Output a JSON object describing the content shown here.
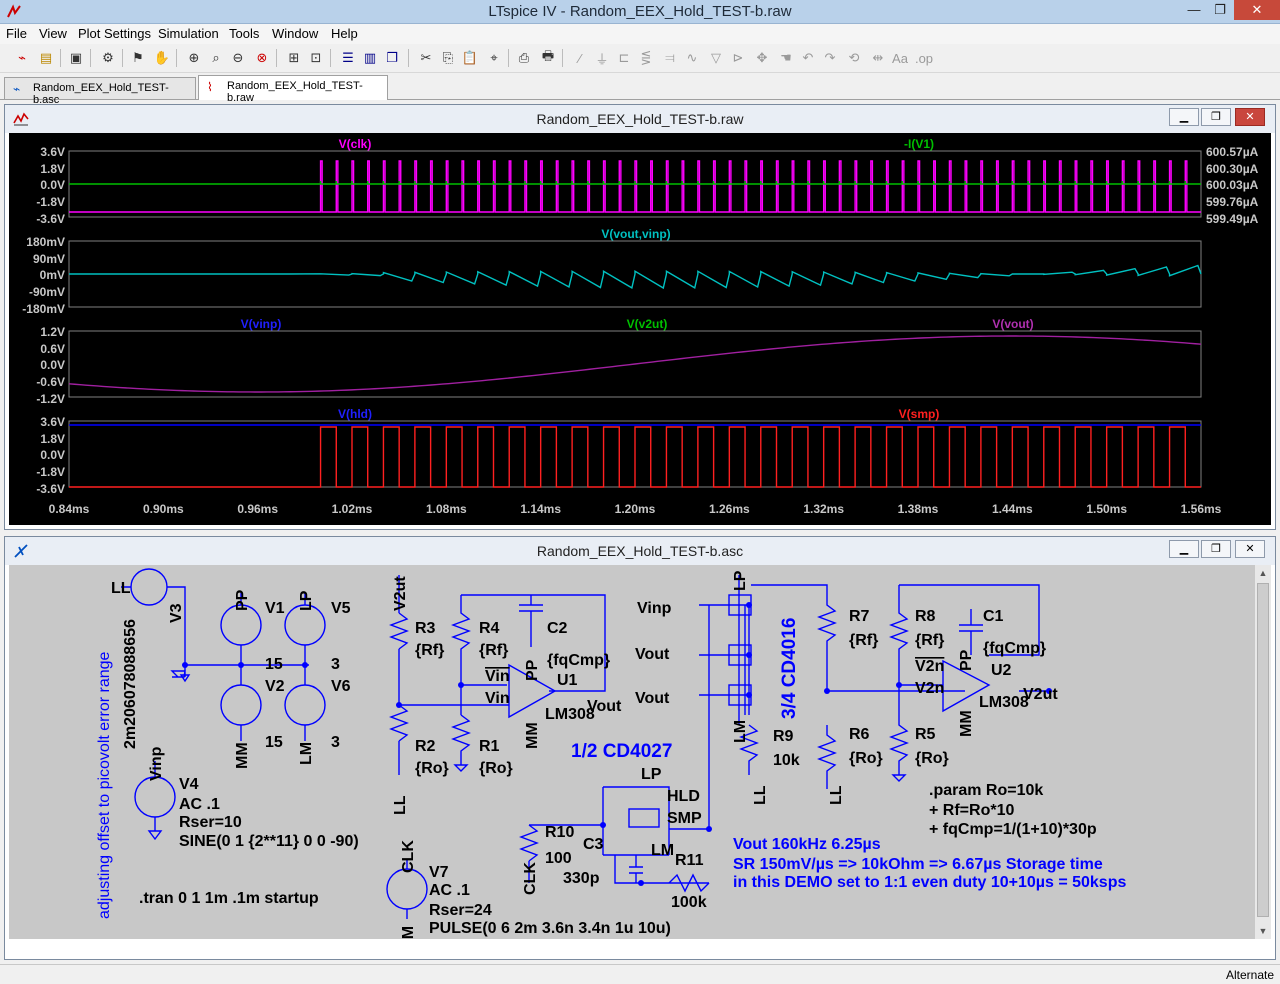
{
  "window": {
    "title": "LTspice IV - Random_EEX_Hold_TEST-b.raw",
    "minimize": "—",
    "restore": "❐",
    "close": "✕"
  },
  "menu": [
    "File",
    "View",
    "Plot Settings",
    "Simulation",
    "Tools",
    "Window",
    "Help"
  ],
  "tabs": [
    {
      "label": "Random_EEX_Hold_TEST-b.asc",
      "icon": "schematic-icon",
      "active": false
    },
    {
      "label": "Random_EEX_Hold_TEST-b.raw",
      "icon": "waveform-icon",
      "active": true
    }
  ],
  "plot_window": {
    "title": "Random_EEX_Hold_TEST-b.raw",
    "panes": [
      {
        "traces": [
          {
            "name": "V(clk)",
            "color": "#ff00ff"
          },
          {
            "name": "-I(V1)",
            "color": "#00c000"
          }
        ],
        "y_left": [
          "3.6V",
          "1.8V",
          "0.0V",
          "-1.8V",
          "-3.6V"
        ],
        "y_right": [
          "600.57µA",
          "600.30µA",
          "600.03µA",
          "599.76µA",
          "599.49µA"
        ]
      },
      {
        "traces": [
          {
            "name": "V(vout,vinp)",
            "color": "#00c0c0"
          }
        ],
        "y_left": [
          "180mV",
          "90mV",
          "0mV",
          "-90mV",
          "-180mV"
        ]
      },
      {
        "traces": [
          {
            "name": "V(vinp)",
            "color": "#0000ff"
          },
          {
            "name": "V(v2ut)",
            "color": "#00c000"
          },
          {
            "name": "V(vout)",
            "color": "#a020a0"
          }
        ],
        "y_left": [
          "1.2V",
          "0.6V",
          "0.0V",
          "-0.6V",
          "-1.2V"
        ]
      },
      {
        "traces": [
          {
            "name": "V(hld)",
            "color": "#0000ff"
          },
          {
            "name": "V(smp)",
            "color": "#ff2020"
          }
        ],
        "y_left": [
          "3.6V",
          "1.8V",
          "0.0V",
          "-1.8V",
          "-3.6V"
        ]
      }
    ],
    "x_ticks": [
      "0.84ms",
      "0.90ms",
      "0.96ms",
      "1.02ms",
      "1.08ms",
      "1.14ms",
      "1.20ms",
      "1.26ms",
      "1.32ms",
      "1.38ms",
      "1.44ms",
      "1.50ms",
      "1.56ms"
    ]
  },
  "schematic_window": {
    "title": "Random_EEX_Hold_TEST-b.asc",
    "texts": {
      "ll1": "LL",
      "v3": "V3",
      "v1": "V1",
      "pp1": "PP",
      "v5": "V5",
      "lp1": "LP",
      "n15a": "15",
      "n3a": "3",
      "v2": "V2",
      "v6": "V6",
      "n15b": "15",
      "n3b": "3",
      "mm1": "MM",
      "lm1": "LM",
      "rot_comment": "adjusting offset to picovolt error range",
      "rot_value": "2m206078088656",
      "vinp_lbl": "Vinp",
      "v4": "V4",
      "v4_ac": "AC .1",
      "v4_rser": "Rser=10",
      "v4_sine": "SINE(0 1 {2**11} 0 0 -90)",
      "tran": ".tran 0 1 1m .1m startup",
      "clk_lbl": "CLK",
      "v7": "V7",
      "v7_ac": "AC .1",
      "v7_rser": "Rser=24",
      "v7_pulse": "PULSE(0 6 2m 3.6n 3.4n 1u 10u)",
      "lm2": "LM",
      "v2ut_top": "V2ut",
      "r3": "R3",
      "rf1": "{Rf}",
      "r4": "R4",
      "rf2": "{Rf}",
      "c2": "C2",
      "fqcmp1": "{fqCmp}",
      "vin_bar": "Vin",
      "pp2": "PP",
      "u1": "U1",
      "vin2": "Vin",
      "lm308a": "LM308",
      "vout_a": "Vout",
      "mm2": "MM",
      "r2": "R2",
      "ro1": "{Ro}",
      "r1": "R1",
      "ro2": "{Ro}",
      "ll2": "LL",
      "cd4027": "1/2 CD4027",
      "lp2": "LP",
      "hld": "HLD",
      "smp": "SMP",
      "lm3": "LM",
      "r10": "R10",
      "n100": "100",
      "c3": "C3",
      "n330p": "330p",
      "r11": "R11",
      "n100k": "100k",
      "clk2": "CLK",
      "vinp2": "Vinp",
      "vout_b": "Vout",
      "vout_c": "Vout",
      "lp3": "LP",
      "cd4016": "3/4 CD4016",
      "lm4": "LM",
      "r9": "R9",
      "n10k": "10k",
      "ll3": "LL",
      "r7": "R7",
      "rf3": "{Rf}",
      "r8": "R8",
      "rf4": "{Rf}",
      "c1": "C1",
      "fqcmp2": "{fqCmp}",
      "v2n_bar": "V2n",
      "pp3": "PP",
      "u2": "U2",
      "v2n": "V2n",
      "lm308b": "LM308",
      "v2ut_out": "V2ut",
      "mm3": "MM",
      "r6": "R6",
      "ro3": "{Ro}",
      "r5": "R5",
      "ro4": "{Ro}",
      "ll4": "LL",
      "param1": ".param Ro=10k",
      "param2": "+ Rf=Ro*10",
      "param3": "+ fqCmp=1/(1+10)*30p",
      "note1": "Vout 160kHz 6.25µs",
      "note2": "SR 150mV/µs => 10kOhm => 6.67µs Storage time",
      "note3": "in this DEMO set to 1:1 even duty 10+10µs = 50ksps"
    }
  },
  "status": "Alternate"
}
